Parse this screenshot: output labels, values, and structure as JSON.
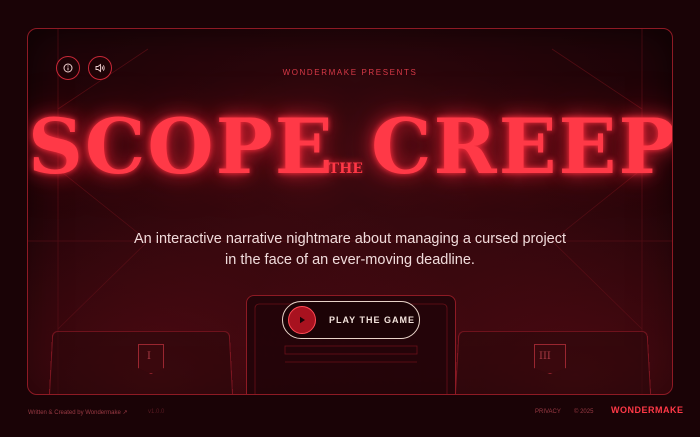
{
  "header": {
    "info_icon": "info-icon",
    "sound_icon": "speaker-icon",
    "presenter": "WONDERMAKE PRESENTS"
  },
  "title": {
    "part1": "SCOPE",
    "the": "THE",
    "part2": "CREEP"
  },
  "tagline": {
    "line1": "An interactive narrative nightmare about managing a cursed project",
    "line2": "in the face of an ever-moving deadline."
  },
  "play_button": {
    "label": "PLAY THE GAME",
    "icon": "play-icon"
  },
  "chapters": {
    "left": "I",
    "right": "III"
  },
  "footer": {
    "credit": "Written & Created by Wondermake",
    "version": "v1.0.0",
    "privacy": "PRIVACY",
    "copyright": "© 2025",
    "brand": "WONDERMAKE"
  },
  "colors": {
    "accent": "#ff3947",
    "border": "#8e1a24",
    "background": "#1a0306"
  }
}
